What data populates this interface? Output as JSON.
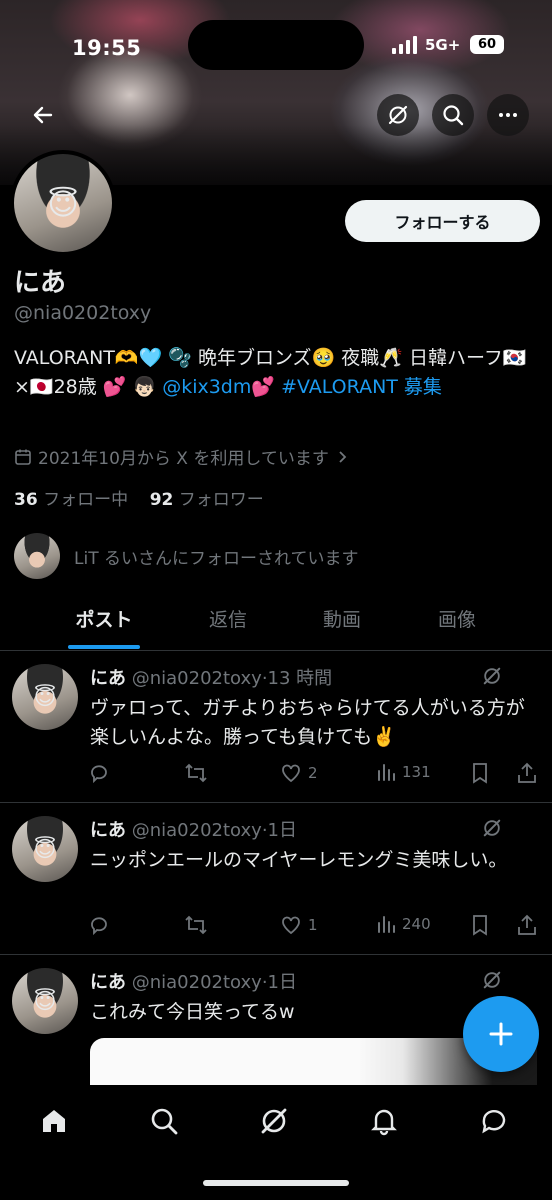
{
  "status_bar": {
    "time": "19:55",
    "network": "5G+",
    "battery": "60"
  },
  "profile": {
    "display_name": "にあ",
    "handle": "@nia0202toxy",
    "follow_button": "フォローする",
    "bio_part1": "VALORANT🫶🩵 🫧 晩年ブロンズ🥹 夜職🥂 日韓ハーフ🇰🇷×🇯🇵28歳 💕 👦🏻 ",
    "bio_mention": "@kix3dm",
    "bio_part2": "💕 ",
    "bio_hashtag": "#VALORANT",
    "bio_part3": " 募集",
    "joined": "2021年10月から X を利用しています",
    "following_count": "36",
    "following_label": "フォロー中",
    "followers_count": "92",
    "followers_label": "フォロワー",
    "followed_by": "LiT るいさんにフォローされています"
  },
  "tabs": [
    "ポスト",
    "返信",
    "動画",
    "画像"
  ],
  "posts": [
    {
      "name": "にあ",
      "handle": "@nia0202toxy",
      "time": "13 時間",
      "text": "ヴァロって、ガチよりおちゃらけてる人がいる方が楽しいんよな。勝っても負けても✌️",
      "likes": "2",
      "views": "131"
    },
    {
      "name": "にあ",
      "handle": "@nia0202toxy",
      "time": "1日",
      "text": "ニッポンエールのマイヤーレモングミ美味しい。",
      "likes": "1",
      "views": "240"
    },
    {
      "name": "にあ",
      "handle": "@nia0202toxy",
      "time": "1日",
      "text": "これみて今日笑ってるw"
    }
  ],
  "colors": {
    "accent": "#1d9bf0",
    "background": "#000000",
    "secondary_text": "#71767b"
  }
}
